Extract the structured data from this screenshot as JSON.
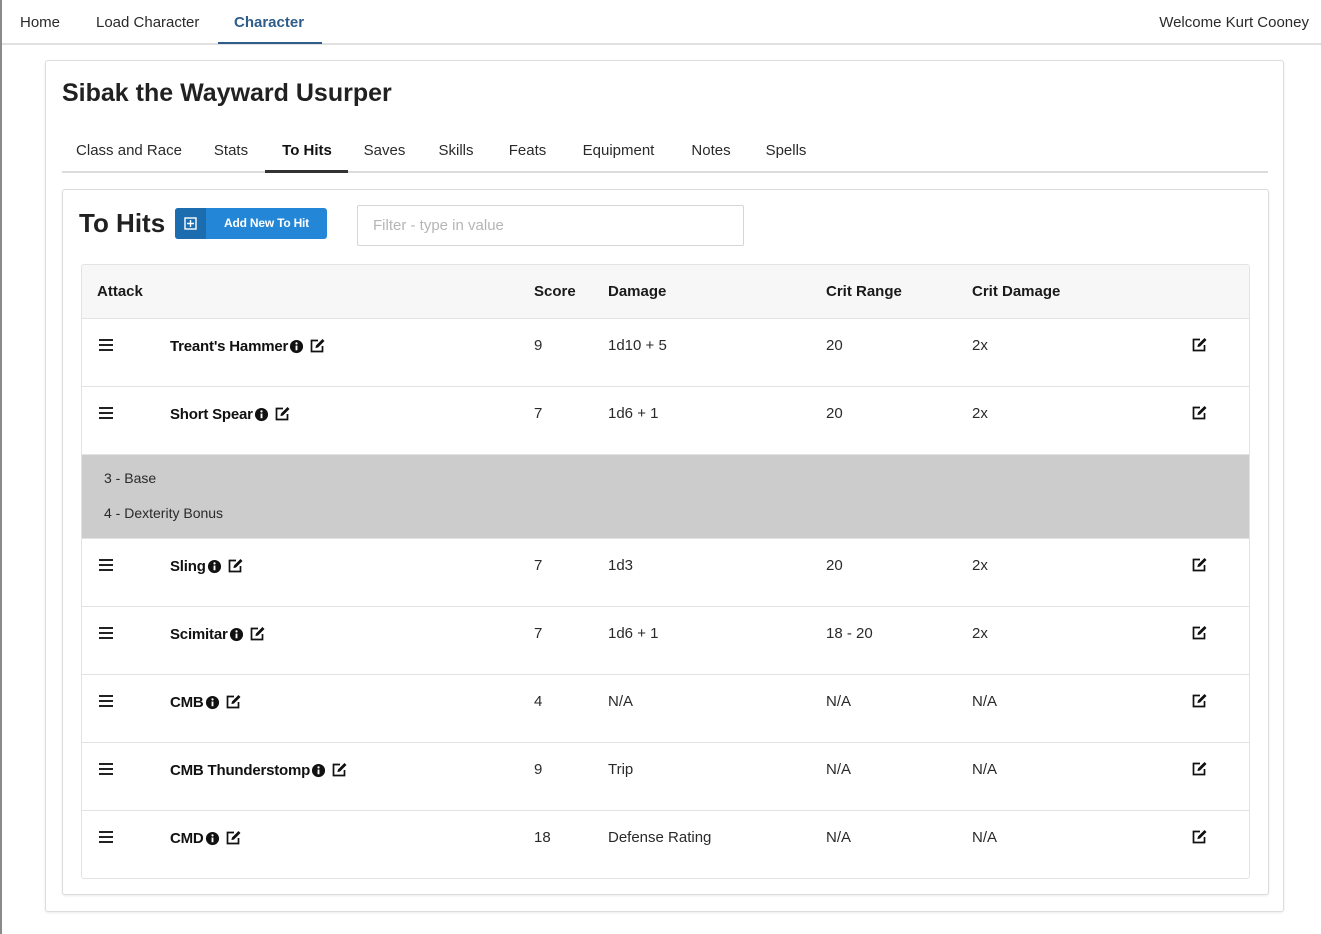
{
  "nav": {
    "items": [
      "Home",
      "Load Character",
      "Character"
    ],
    "active": "Character",
    "welcome": "Welcome Kurt Cooney"
  },
  "character": {
    "name": "Sibak the Wayward Usurper",
    "tabs": [
      "Class and Race",
      "Stats",
      "To Hits",
      "Saves",
      "Skills",
      "Feats",
      "Equipment",
      "Notes",
      "Spells"
    ],
    "active_tab": "To Hits"
  },
  "to_hits": {
    "title": "To Hits",
    "add_button": "Add New To Hit",
    "filter_placeholder": "Filter - type in value",
    "filter_value": "",
    "columns": [
      "Attack",
      "Score",
      "Damage",
      "Crit Range",
      "Crit Damage"
    ],
    "rows": [
      {
        "attack": "Treant's Hammer",
        "score": "9",
        "damage": "1d10 + 5",
        "crit_range": "20",
        "crit_damage": "2x"
      },
      {
        "attack": "Short Spear",
        "score": "7",
        "damage": "1d6 + 1",
        "crit_range": "20",
        "crit_damage": "2x",
        "expanded": true,
        "breakdown": [
          "3 - Base",
          "4 - Dexterity Bonus"
        ]
      },
      {
        "attack": "Sling",
        "score": "7",
        "damage": "1d3",
        "crit_range": "20",
        "crit_damage": "2x"
      },
      {
        "attack": "Scimitar",
        "score": "7",
        "damage": "1d6 + 1",
        "crit_range": "18 - 20",
        "crit_damage": "2x"
      },
      {
        "attack": "CMB",
        "score": "4",
        "damage": "N/A",
        "crit_range": "N/A",
        "crit_damage": "N/A"
      },
      {
        "attack": "CMB Thunderstomp",
        "score": "9",
        "damage": "Trip",
        "crit_range": "N/A",
        "crit_damage": "N/A"
      },
      {
        "attack": "CMD",
        "score": "18",
        "damage": "Defense Rating",
        "crit_range": "N/A",
        "crit_damage": "N/A"
      }
    ]
  },
  "colors": {
    "nav_active": "#2e5d8c",
    "button_blue": "#2486d6",
    "button_icon_blue": "#1b6db0",
    "detail_bg": "#cccccc"
  },
  "icons": {
    "drag": "drag-handle-icon",
    "info": "info-circle-icon",
    "edit": "edit-square-icon",
    "add": "plus-square-icon"
  }
}
